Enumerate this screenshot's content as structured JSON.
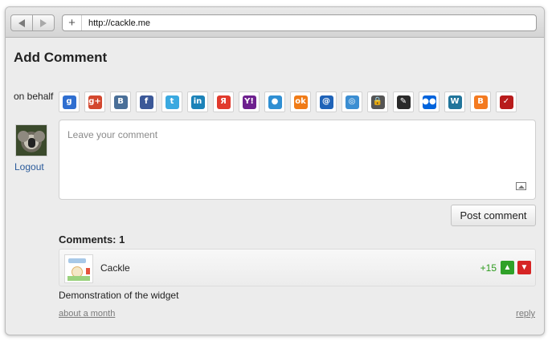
{
  "browser": {
    "url": "http://cackle.me",
    "back_icon": "back-arrow-icon",
    "forward_icon": "forward-arrow-icon",
    "new_tab_icon": "plus-icon",
    "new_tab_glyph": "+"
  },
  "page": {
    "title": "Add Comment",
    "on_behalf_label": "on behalf"
  },
  "providers": [
    {
      "name": "google-icon",
      "glyph": "g",
      "color": "#2f6ed0"
    },
    {
      "name": "google-plus-icon",
      "glyph": "g+",
      "color": "#d3472e"
    },
    {
      "name": "vkontakte-icon",
      "glyph": "B",
      "color": "#4a6f98"
    },
    {
      "name": "facebook-icon",
      "glyph": "f",
      "color": "#3b5898"
    },
    {
      "name": "twitter-icon",
      "glyph": "t",
      "color": "#3aa9e0"
    },
    {
      "name": "linkedin-icon",
      "glyph": "in",
      "color": "#1b82b8"
    },
    {
      "name": "yandex-icon",
      "glyph": "Я",
      "color": "#e13a2d"
    },
    {
      "name": "yahoo-icon",
      "glyph": "Y!",
      "color": "#6d1f8e"
    },
    {
      "name": "mail-agent-icon",
      "glyph": "●",
      "color": "#2f8fd3"
    },
    {
      "name": "odnoklassniki-icon",
      "glyph": "ok",
      "color": "#f07b17"
    },
    {
      "name": "mail-ru-icon",
      "glyph": "@",
      "color": "#1f63b8"
    },
    {
      "name": "rambler-icon",
      "glyph": "◎",
      "color": "#3b8ed2"
    },
    {
      "name": "lock-icon",
      "glyph": "🔒",
      "color": "#555555"
    },
    {
      "name": "pencil-icon",
      "glyph": "✎",
      "color": "#2a2a2a"
    },
    {
      "name": "flickr-icon",
      "glyph": "●●",
      "color": "#0063dc"
    },
    {
      "name": "wordpress-icon",
      "glyph": "W",
      "color": "#21759b"
    },
    {
      "name": "blogger-icon",
      "glyph": "B",
      "color": "#f47a20"
    },
    {
      "name": "checkmark-icon",
      "glyph": "✓",
      "color": "#b81b1b"
    }
  ],
  "user": {
    "avatar_icon": "koala-avatar",
    "logout_label": "Logout"
  },
  "comment_form": {
    "placeholder": "Leave your comment",
    "image_icon": "image-upload-icon",
    "submit_label": "Post comment"
  },
  "comments": {
    "count_label": "Comments: 1",
    "items": [
      {
        "author": "Cackle",
        "avatar_icon": "cackle-avatar",
        "score": "+15",
        "upvote_icon": "thumbs-up-icon",
        "downvote_icon": "thumbs-down-icon",
        "text": "Demonstration of the widget",
        "time": "about a month",
        "reply_label": "reply"
      }
    ]
  },
  "colors": {
    "link": "#2a5a9a",
    "score": "#2e9b1f",
    "upvote": "#2fa128",
    "downvote": "#d62424"
  }
}
